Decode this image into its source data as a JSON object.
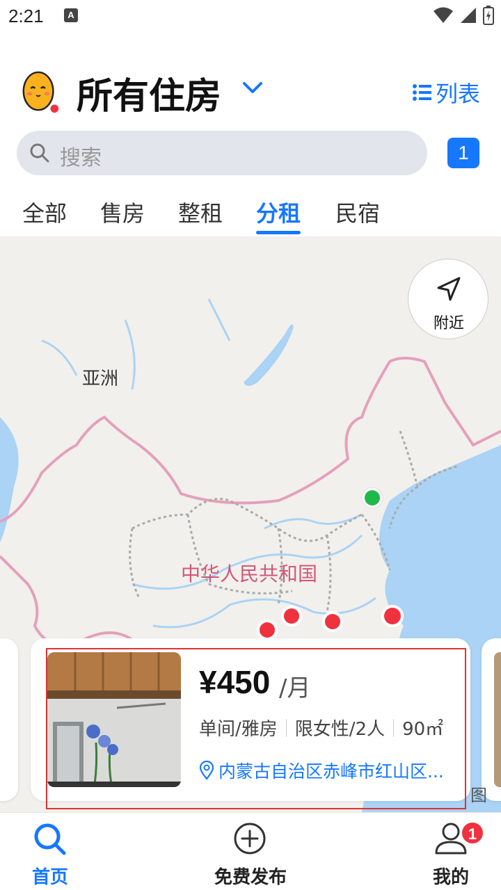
{
  "status_bar": {
    "time": "2:21",
    "notification_glyph": "A"
  },
  "header": {
    "title": "所有住房",
    "list_label": "列表"
  },
  "search": {
    "placeholder": "搜索",
    "count": "1"
  },
  "tabs": [
    {
      "label": "全部",
      "active": false
    },
    {
      "label": "售房",
      "active": false
    },
    {
      "label": "整租",
      "active": false
    },
    {
      "label": "分租",
      "active": true
    },
    {
      "label": "民宿",
      "active": false
    }
  ],
  "map": {
    "region_label": "亚洲",
    "country_label": "中华人民共和国",
    "nearby_label": "附近",
    "watermark": "图",
    "markers": [
      {
        "color": "#1fb94a",
        "kind": "current"
      },
      {
        "color": "#f0323f",
        "kind": "listing"
      },
      {
        "color": "#f0323f",
        "kind": "listing"
      },
      {
        "color": "#f0323f",
        "kind": "listing"
      },
      {
        "color": "#f0323f",
        "kind": "listing"
      }
    ]
  },
  "listing": {
    "price": "¥450",
    "price_unit": "/月",
    "room_type": "单间/雅房",
    "tenants": "限女性/2人",
    "area": "90㎡",
    "location": "内蒙古自治区赤峰市红山区..."
  },
  "bottom_nav": {
    "home": "首页",
    "publish": "免费发布",
    "mine": "我的",
    "mine_badge": "1"
  },
  "colors": {
    "accent": "#1677ff",
    "alert": "#f0323f",
    "current_location": "#1fb94a"
  }
}
